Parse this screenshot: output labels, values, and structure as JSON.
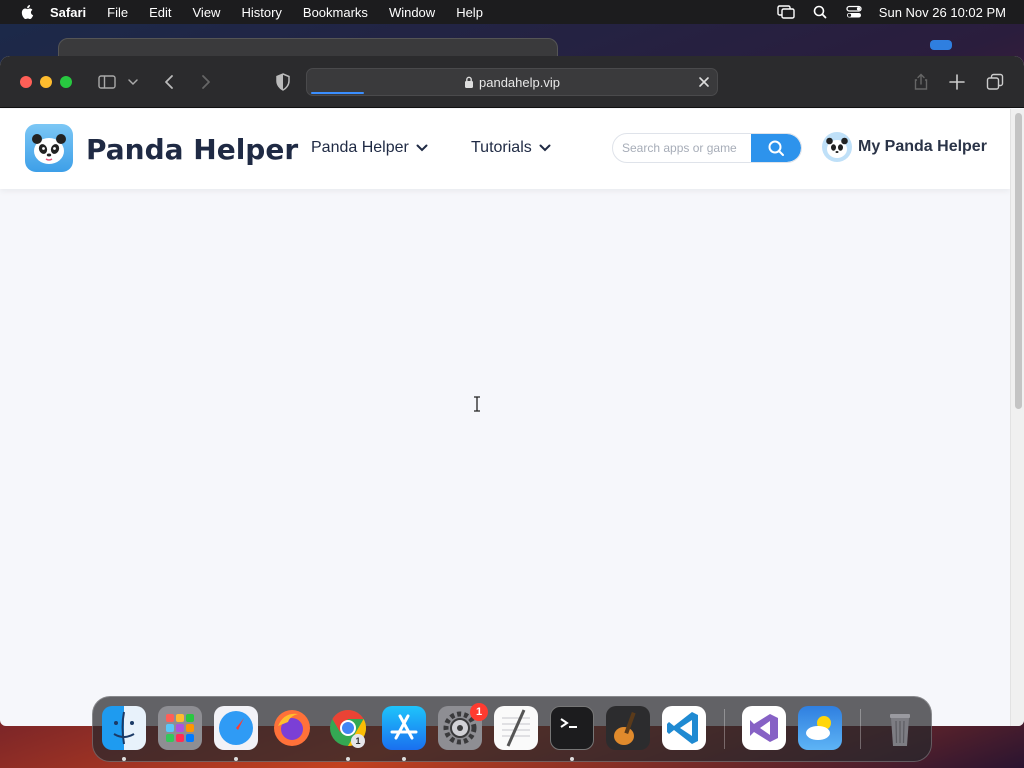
{
  "menubar": {
    "app_name": "Safari",
    "items": [
      "File",
      "Edit",
      "View",
      "History",
      "Bookmarks",
      "Window",
      "Help"
    ],
    "clock": "Sun Nov 26  10:02 PM"
  },
  "browser": {
    "url": "pandahelp.vip",
    "page_load_progress": 0.13
  },
  "site": {
    "logo_text": "Panda Helper",
    "nav": [
      {
        "label": "Panda Helper"
      },
      {
        "label": "Tutorials"
      }
    ],
    "search_placeholder": "Search apps or game",
    "account_label": "My Panda Helper",
    "accent_color": "#2d93ec"
  },
  "dock": {
    "apps": [
      {
        "name": "Finder",
        "icon": "finder-icon"
      },
      {
        "name": "Launchpad",
        "icon": "launchpad-icon"
      },
      {
        "name": "Safari",
        "icon": "safari-icon"
      },
      {
        "name": "Firefox",
        "icon": "firefox-icon"
      },
      {
        "name": "Google Chrome",
        "icon": "chrome-icon"
      },
      {
        "name": "App Store",
        "icon": "app-store-icon"
      },
      {
        "name": "System Settings",
        "icon": "settings-icon",
        "badge": "1"
      },
      {
        "name": "TextEdit",
        "icon": "textedit-icon"
      },
      {
        "name": "Terminal",
        "icon": "terminal-icon"
      },
      {
        "name": "GarageBand",
        "icon": "garageband-icon"
      },
      {
        "name": "Visual Studio Code",
        "icon": "vscode-icon"
      },
      {
        "name": "Visual Studio",
        "icon": "visual-studio-icon"
      },
      {
        "name": "Weather",
        "icon": "weather-icon"
      },
      {
        "name": "Trash",
        "icon": "trash-icon"
      }
    ],
    "chrome_badge": "1"
  }
}
